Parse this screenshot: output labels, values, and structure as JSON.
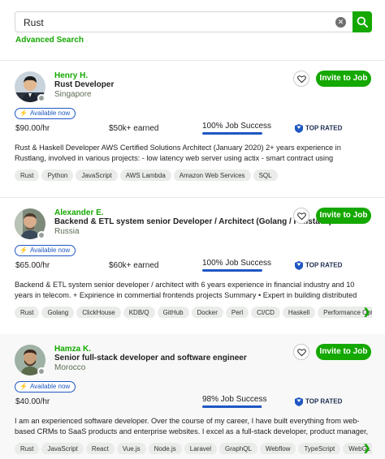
{
  "search": {
    "value": "Rust",
    "placeholder": "",
    "advanced_label": "Advanced Search"
  },
  "colors": {
    "accent": "#14a800",
    "badge_blue": "#1f57c3"
  },
  "cards": [
    {
      "name": "Henry H.",
      "title": "Rust Developer",
      "location": "Singapore",
      "invite_label": "Invite to Job",
      "available_label": "Available now",
      "rate": "$90.00/hr",
      "earned": "$50k+ earned",
      "job_success": "100% Job Success",
      "job_success_pct": 100,
      "top_rated": "TOP RATED",
      "description": "Rust & Haskell Developer AWS Certified Solutions Architect (January 2020) 2+ years experience in Rustlang, involved in various projects: - low latency web server using actix - smart contract using cosmwasm sdk (terra,...",
      "skills": [
        "Rust",
        "Python",
        "JavaScript",
        "AWS Lambda",
        "Amazon Web Services",
        "SQL"
      ],
      "has_more_skills": false
    },
    {
      "name": "Alexander E.",
      "title": "Backend & ETL system senior Developer / Architect (Golang / Fullstack)",
      "location": "Russia",
      "invite_label": "Invite to Job",
      "available_label": "Available now",
      "rate": "$65.00/hr",
      "earned": "$60k+ earned",
      "job_success": "100% Job Success",
      "job_success_pct": 100,
      "top_rated": "TOP RATED",
      "description": "Backend & ETL system senior developer / architect with 6 years experience in financial industry and 10 years in telecom. + Expirience in commertial frontends projects Summary • Expert in building distributed and parallel...",
      "skills": [
        "Rust",
        "Golang",
        "ClickHouse",
        "KDB/Q",
        "GitHub",
        "Docker",
        "Perl",
        "CI/CD",
        "Haskell",
        "Performance Optin"
      ],
      "has_more_skills": true
    },
    {
      "name": "Hamza K.",
      "title": "Senior full-stack developer and software engineer",
      "location": "Morocco",
      "invite_label": "Invite to Job",
      "available_label": "Available now",
      "rate": "$40.00/hr",
      "earned": "",
      "job_success": "98% Job Success",
      "job_success_pct": 98,
      "top_rated": "TOP RATED",
      "description": "I am an experienced software developer. Over the course of my career, I have built everything from web-based CRMs to SaaS products and enterprise websites. I excel as a full-stack developer, product manager, or...",
      "skills": [
        "Rust",
        "JavaScript",
        "React",
        "Vue.js",
        "Node.js",
        "Laravel",
        "GraphQL",
        "Webflow",
        "TypeScript",
        "WebGL"
      ],
      "has_more_skills": true
    }
  ]
}
